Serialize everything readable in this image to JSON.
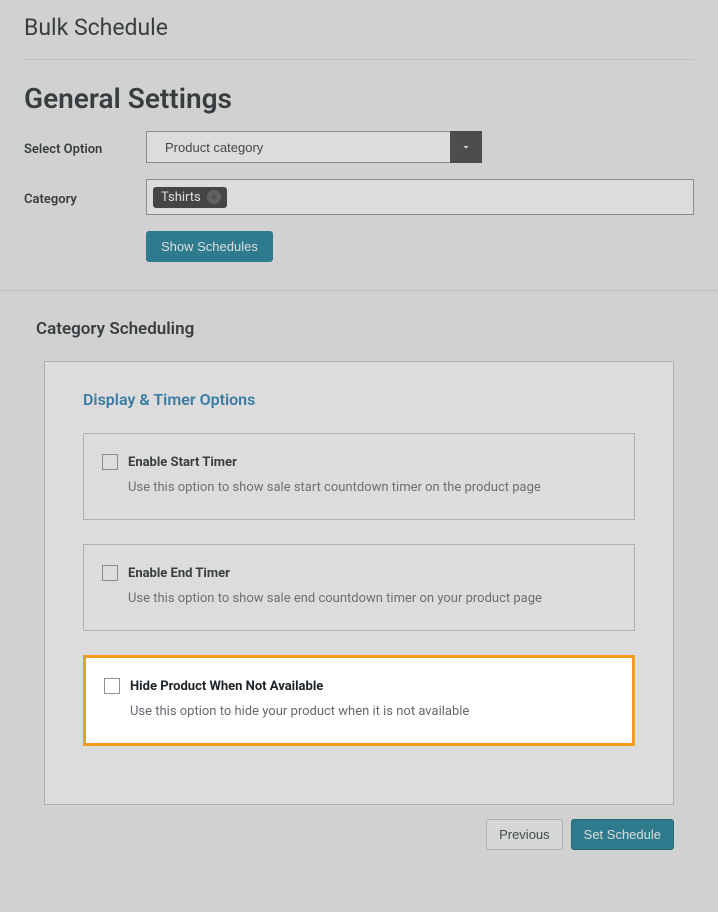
{
  "page": {
    "title": "Bulk Schedule"
  },
  "general": {
    "heading": "General Settings",
    "select_option_label": "Select Option",
    "select_option_value": "Product category",
    "category_label": "Category",
    "category_tags": [
      "Tshirts"
    ],
    "show_schedules_btn": "Show Schedules"
  },
  "scheduling": {
    "heading": "Category Scheduling",
    "panel_heading": "Display & Timer Options",
    "options": [
      {
        "title": "Enable Start Timer",
        "desc": "Use this option to show sale start countdown timer on the product page",
        "checked": false,
        "highlighted": false
      },
      {
        "title": "Enable End Timer",
        "desc": "Use this option to show sale end countdown timer on your product page",
        "checked": false,
        "highlighted": false
      },
      {
        "title": "Hide Product When Not Available",
        "desc": "Use this option to hide your product when it is not available",
        "checked": false,
        "highlighted": true
      }
    ]
  },
  "footer": {
    "previous": "Previous",
    "set_schedule": "Set Schedule"
  }
}
